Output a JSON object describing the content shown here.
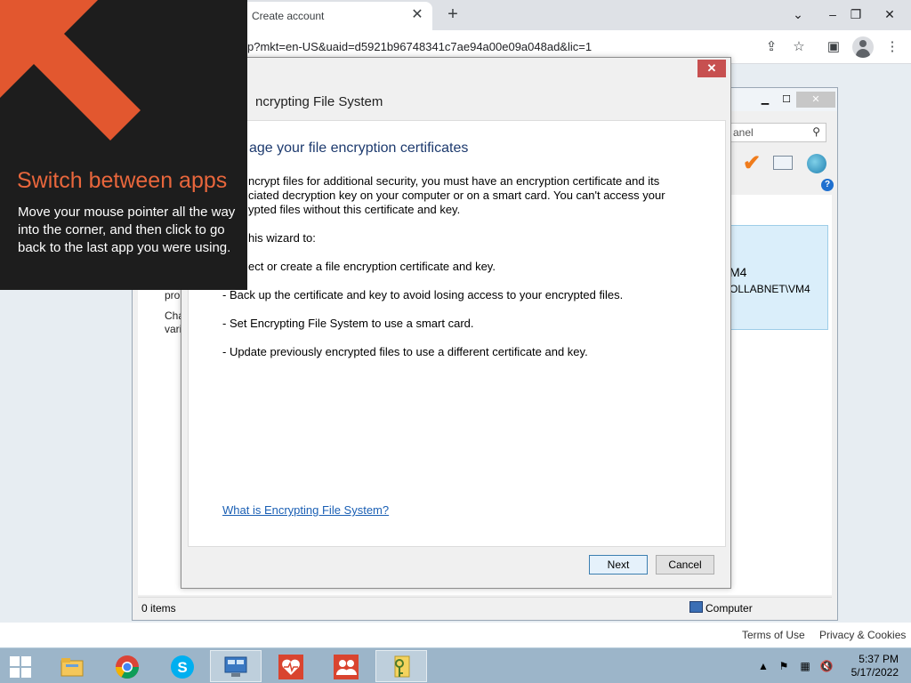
{
  "browser": {
    "tab_title": "Create account",
    "url": "p?mkt=en-US&uaid=d5921b96748341c7ae94a00e09a048ad&lic=1",
    "footer_links": [
      "Terms of Use",
      "Privacy & Cookies"
    ]
  },
  "tip": {
    "title": "Switch between apps",
    "body": "Move your mouse pointer all the way into the corner, and then click to go back to the last app you were using.",
    "accent_color": "#e8663c"
  },
  "explorer": {
    "search_placeholder": "anel",
    "user_tile": {
      "name": "M4",
      "account": "OLLABNET\\VM4"
    },
    "fragments": [
      "pro",
      "Cha",
      "vari"
    ],
    "status_items": "0 items",
    "status_location": "Computer"
  },
  "dialog": {
    "title": "ncrypting File System",
    "heading": "age your file encryption certificates",
    "intro_lines": [
      "ncrypt files for additional security, you must have an encryption certificate and its",
      "ciated decryption key on your computer or on a smart card. You can't access your",
      "ypted files without this certificate and key."
    ],
    "use_line": "his wizard to:",
    "bullets": [
      "ect or create a file encryption certificate and key.",
      "- Back up the certificate and key to avoid losing access to your encrypted files.",
      "- Set Encrypting File System to use a smart card.",
      "- Update previously encrypted files to use a different certificate and key."
    ],
    "link": "What is Encrypting File System?",
    "next_label": "Next",
    "cancel_label": "Cancel"
  },
  "taskbar": {
    "apps": [
      "file-explorer",
      "chrome",
      "skype",
      "remote-desktop-manager",
      "health-app",
      "people-app",
      "key-manager"
    ],
    "time": "5:37 PM",
    "date": "5/17/2022"
  }
}
